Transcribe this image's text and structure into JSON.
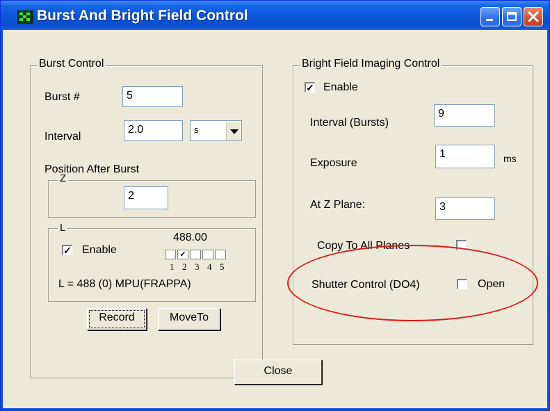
{
  "window": {
    "title": "Burst And Bright Field Control",
    "icon": "app-icon"
  },
  "burst": {
    "group_label": "Burst Control",
    "burst_label": "Burst #",
    "burst_value": "5",
    "interval_label": "Interval",
    "interval_value": "2.0",
    "interval_unit": "s",
    "position_label": "Position After Burst",
    "z_label": "Z",
    "z_value": "2",
    "l_label": "L",
    "l_value_top": "488.00",
    "l_enable_label": "Enable",
    "l_enable_checked": true,
    "l_boxes": [
      {
        "checked": false
      },
      {
        "checked": true
      },
      {
        "checked": false
      },
      {
        "checked": false
      },
      {
        "checked": false
      }
    ],
    "l_numbers": [
      "1",
      "2",
      "3",
      "4",
      "5"
    ],
    "l_summary": "L = 488 (0) MPU(FRAPPA)",
    "record_label": "Record",
    "moveto_label": "MoveTo"
  },
  "brightfield": {
    "group_label": "Bright Field Imaging Control",
    "enable_label": "Enable",
    "enable_checked": true,
    "interval_label": "Interval (Bursts)",
    "interval_value": "9",
    "exposure_label": "Exposure",
    "exposure_value": "1",
    "exposure_unit": "ms",
    "zplane_label": "At Z Plane:",
    "zplane_value": "3",
    "copy_label": "Copy To All Planes",
    "copy_checked": false,
    "shutter_label": "Shutter Control (DO4)",
    "shutter_open_label": "Open",
    "shutter_checked": false
  },
  "footer": {
    "close_label": "Close"
  },
  "colors": {
    "highlight_ellipse": "#e11a1a",
    "titlebar": "#0b55d8",
    "dialog_bg": "#ece9d8"
  }
}
